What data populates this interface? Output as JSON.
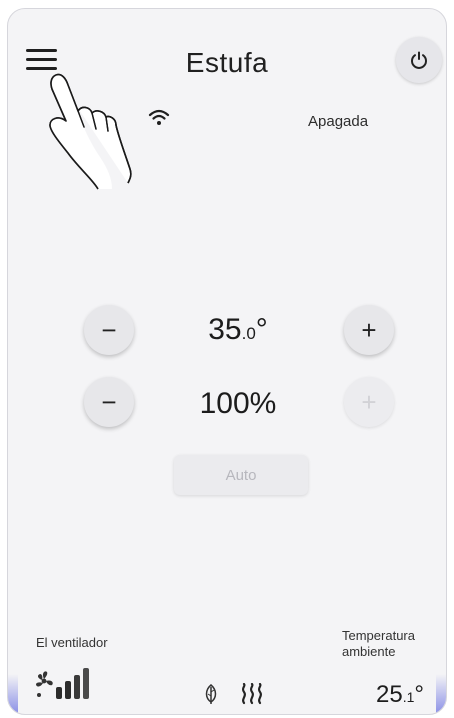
{
  "header": {
    "title": "Estufa"
  },
  "status": {
    "state": "Apagada"
  },
  "temperature_setpoint": {
    "value": "35",
    "decimal": ".0",
    "unit": "°",
    "minus": "−",
    "plus": "+"
  },
  "power_level": {
    "value": "100%",
    "minus": "−",
    "plus": "+"
  },
  "mode": {
    "auto_label": "Auto"
  },
  "footer": {
    "fan_label": "El ventilador",
    "ambient_label_line1": "Temperatura",
    "ambient_label_line2": "ambiente",
    "ambient_value": "25",
    "ambient_decimal": ".1",
    "ambient_unit": "°"
  },
  "icons": [
    "menu-icon",
    "power-icon",
    "wifi-icon",
    "fan-icon",
    "signal-bars-icon",
    "leaf-icon",
    "heat-icon",
    "hand-pointer-icon"
  ],
  "colors": {
    "background": "#f4f4f6",
    "button": "#e7e7ea",
    "disabled_text": "#b7b7bd",
    "edge_accent": "#8a8fe6"
  }
}
